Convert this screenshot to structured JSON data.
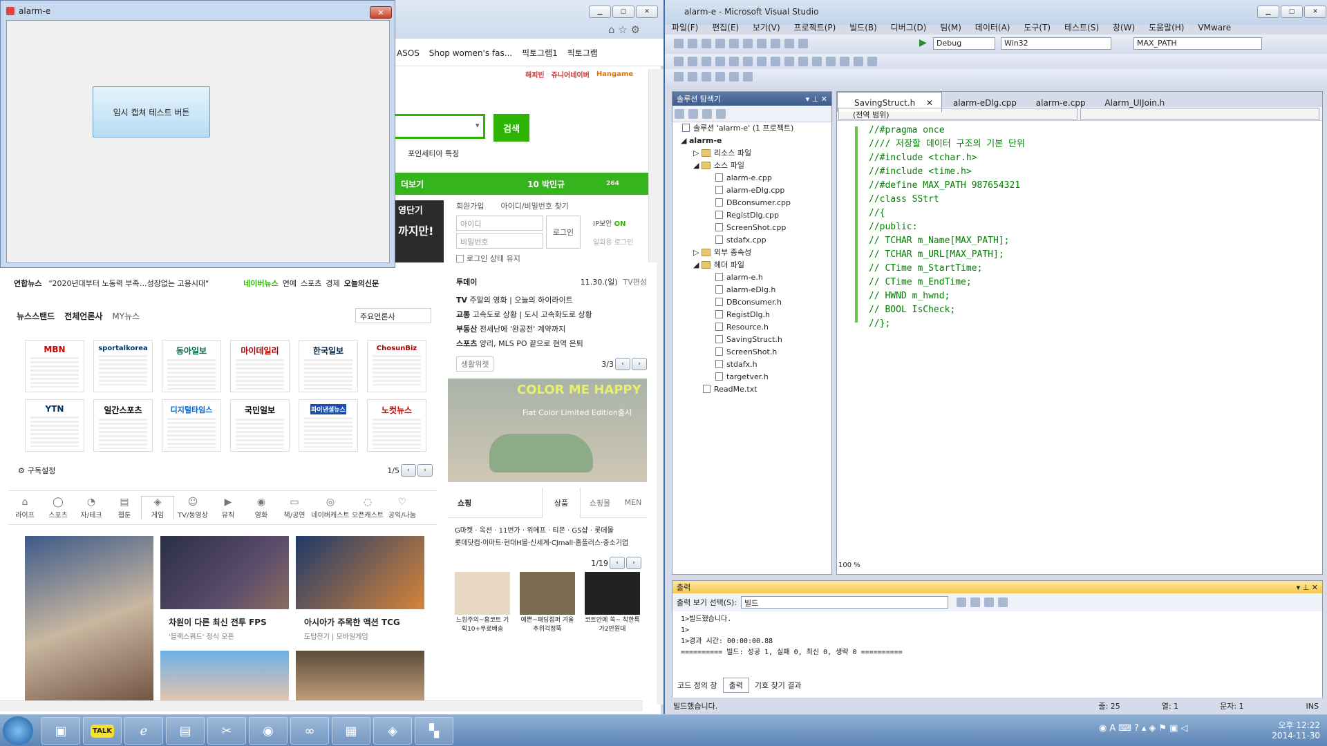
{
  "small_window": {
    "title": "alarm-e",
    "button_label": "임시 캡쳐 테스트 버튼",
    "close_glyph": "✕"
  },
  "browser": {
    "favorites": [
      "ASOS",
      "Shop women's fas...",
      "픽토그램1",
      "픽토그램"
    ],
    "top_links": [
      "해피빈",
      "쥬니어네이버",
      "Hangame"
    ],
    "search_button": "검색",
    "search_sub": "포인세티아 특징",
    "green_bar_left": "더보기",
    "green_bar_right": "10 박민규",
    "green_bar_count": "264",
    "ad_text": [
      "영단기",
      "까지만!"
    ],
    "login": {
      "join": "회원가입",
      "find": "아이디/비밀번호 찾기",
      "id_placeholder": "아이디",
      "pw_placeholder": "비밀번호",
      "login_button": "로그인",
      "ip_label": "IP보안",
      "ip_state": "ON",
      "onetime": "일회용 로그인",
      "keep": "로그인 상태 유지"
    },
    "newsbar": {
      "source": "연합뉴스",
      "headline": "\"2020년대부터 노동력 부족…성장없는 고용시대\"",
      "links": [
        "네이버뉴스",
        "연예",
        "스포츠",
        "경제",
        "오늘의신문"
      ]
    },
    "newsstand": {
      "tabs": [
        "뉴스스탠드",
        "전체언론사",
        "MY뉴스"
      ],
      "dropdown": "주요언론사",
      "logos_row1": [
        "MBN",
        "sportalkorea",
        "동아일보",
        "마이데일리",
        "한국일보",
        "ChosunBiz"
      ],
      "logos_row2": [
        "YTN",
        "일간스포츠",
        "디지털타임스",
        "국민일보",
        "파이낸셜뉴스",
        "노컷뉴스"
      ],
      "settings": "구독설정",
      "page": "1/5"
    },
    "today": {
      "title": "투데이",
      "date": "11.30.(일)",
      "tv_label": "TV편성",
      "rows": [
        {
          "k": "TV",
          "v": "주말의 영화  |  오늘의 하이라이트"
        },
        {
          "k": "교통",
          "v": "고속도로 상황  |  도시 고속화도로 상황"
        },
        {
          "k": "부동산",
          "v": "전세난에 '완공전' 계약까지"
        },
        {
          "k": "스포츠",
          "v": "양리, MLS PO 끝으로 현역 은퇴"
        }
      ],
      "widget": "생활위젯",
      "page": "3/3"
    },
    "banner": {
      "title": "COLOR ME HAPPY",
      "sub": "Fiat Color Limited Edition출시"
    },
    "nav": [
      "라이프",
      "스포츠",
      "자/테크",
      "웹툰",
      "게임",
      "TV/동영상",
      "뮤직",
      "영화",
      "책/공연",
      "네이버캐스트",
      "오픈캐스트",
      "공익/나눔"
    ],
    "games": [
      {
        "title": "차원이 다른 최신 전투 FPS",
        "sub": "'블랙스쿼드' 정식 오픈"
      },
      {
        "title": "아시아가 주목한 액션 TCG",
        "sub": "도탑전기  |  모바일게임"
      }
    ],
    "shopping": {
      "title": "쇼핑",
      "tabs": [
        "상품",
        "쇼핑몰",
        "MEN"
      ],
      "malls1": "G마켓 · 옥션 · 11번가 · 위메프 · 티몬 · GS샵 · 롯데몰",
      "malls2": "롯데닷컴·이마트·현대H몰·신세계·CJmall·홈플러스·중소기업",
      "page": "1/19",
      "items": [
        "느낌주의~홈코트 기획10+무료배송",
        "예쁜~패딩점퍼 겨울추위걱정뚝",
        "코트안에 쏙~ 착한특가2만원대"
      ]
    }
  },
  "vs": {
    "title": "alarm-e - Microsoft Visual Studio",
    "menu": [
      "파일(F)",
      "편집(E)",
      "보기(V)",
      "프로젝트(P)",
      "빌드(B)",
      "디버그(D)",
      "팀(M)",
      "데이터(A)",
      "도구(T)",
      "테스트(S)",
      "창(W)",
      "도움말(H)",
      "VMware"
    ],
    "config": "Debug",
    "platform": "Win32",
    "find_box": "MAX_PATH",
    "solution_explorer": {
      "title": "솔루션 탐색기",
      "solution": "솔루션 'alarm-e' (1 프로젝트)",
      "project": "alarm-e",
      "folders": {
        "resources": "리소스 파일",
        "source": "소스 파일",
        "external": "외부 종속성",
        "header": "헤더 파일"
      },
      "source_files": [
        "alarm-e.cpp",
        "alarm-eDlg.cpp",
        "DBconsumer.cpp",
        "RegistDlg.cpp",
        "ScreenShot.cpp",
        "stdafx.cpp"
      ],
      "header_files": [
        "alarm-e.h",
        "alarm-eDlg.h",
        "DBconsumer.h",
        "RegistDlg.h",
        "Resource.h",
        "SavingStruct.h",
        "ScreenShot.h",
        "stdafx.h",
        "targetver.h"
      ],
      "readme": "ReadMe.txt"
    },
    "tabs": [
      "SavingStruct.h",
      "alarm-eDlg.cpp",
      "alarm-e.cpp",
      "Alarm_UIJoin.h"
    ],
    "scope": "(전역 범위)",
    "code": [
      "//#pragma once",
      "//// 저장할 데이터 구조의 기본 단위",
      "//#include <tchar.h>",
      "//#include <time.h>",
      "//#define MAX_PATH 987654321",
      "//class SStrt",
      "//{",
      "//public:",
      "//  TCHAR m_Name[MAX_PATH];",
      "//  TCHAR m_URL[MAX_PATH];",
      "//  CTime m_StartTime;",
      "//  CTime m_EndTime;",
      "//  HWND m_hwnd;",
      "//  BOOL IsCheck;",
      "//};"
    ],
    "zoom": "100 %",
    "output": {
      "title": "출력",
      "select_label": "출력 보기 선택(S):",
      "select_value": "빌드",
      "lines": [
        "1>빌드했습니다.",
        "1>",
        "1>경과 시간: 00:00:00.88",
        "========== 빌드: 성공 1, 실패 0, 최신 0, 생략 0 =========="
      ]
    },
    "bottom_tabs": [
      "코드 정의 창",
      "출력",
      "기호 찾기 결과"
    ],
    "status": {
      "left": "빌드했습니다.",
      "line": "줄: 25",
      "col": "열: 1",
      "char": "문자: 1",
      "mode": "INS"
    }
  },
  "taskbar": {
    "talk_label": "TALK",
    "time": "오후 12:22",
    "date": "2014-11-30"
  }
}
